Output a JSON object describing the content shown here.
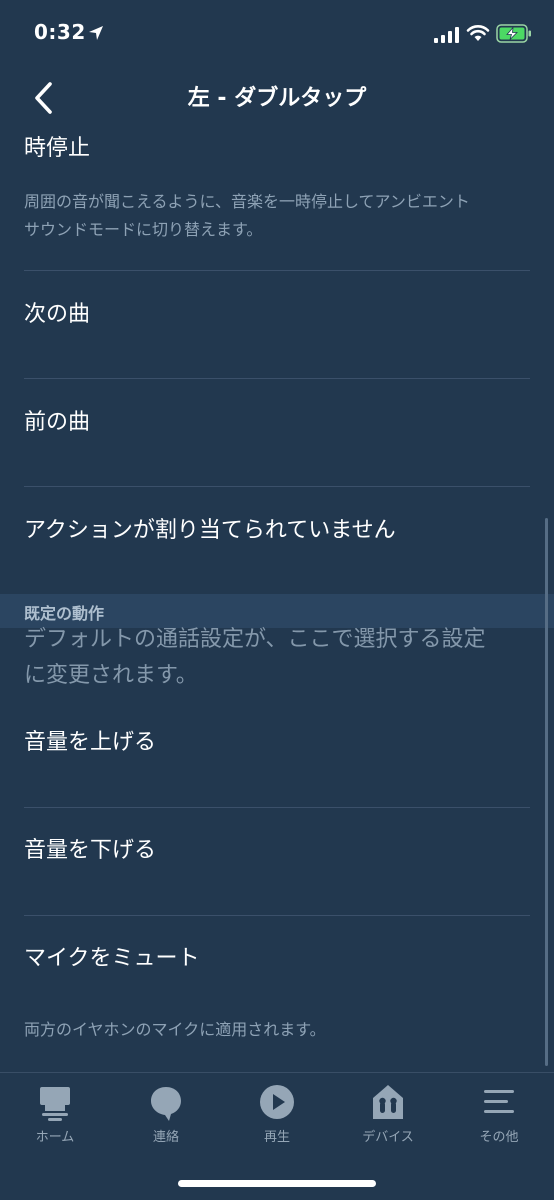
{
  "status_bar": {
    "time": "0:32"
  },
  "nav": {
    "title": "左 - ダブルタップ"
  },
  "items": {
    "pause": {
      "label": "時停止",
      "description_line1": "周囲の音が聞こえるように、音楽を一時停止してアンビエント",
      "description_line2": "サウンドモードに切り替えます。"
    },
    "next_track": {
      "label": "次の曲"
    },
    "previous_track": {
      "label": "前の曲"
    },
    "no_action": {
      "label": "アクションが割り当てられていません"
    },
    "volume_up": {
      "label": "音量を上げる"
    },
    "volume_down": {
      "label": "音量を下げる"
    },
    "mic_mute": {
      "label": "マイクをミュート",
      "description": "両方のイヤホンのマイクに適用されます。"
    }
  },
  "section": {
    "header": "既定の動作",
    "description_line1": "デフォルトの通話設定が、ここで選択する設定",
    "description_line2": "に変更されます。"
  },
  "tabs": [
    {
      "label": "ホーム",
      "icon": "home-icon"
    },
    {
      "label": "連絡",
      "icon": "chat-bubble-icon"
    },
    {
      "label": "再生",
      "icon": "play-icon"
    },
    {
      "label": "デバイス",
      "icon": "device-icon"
    },
    {
      "label": "その他",
      "icon": "menu-icon"
    }
  ],
  "colors": {
    "background": "#22384f",
    "section_header_bg": "#2b4561",
    "divider": "#3b506a",
    "muted_text": "#8ea2b5",
    "tab_icon": "#95a6b6",
    "battery_green": "#4cd964"
  }
}
